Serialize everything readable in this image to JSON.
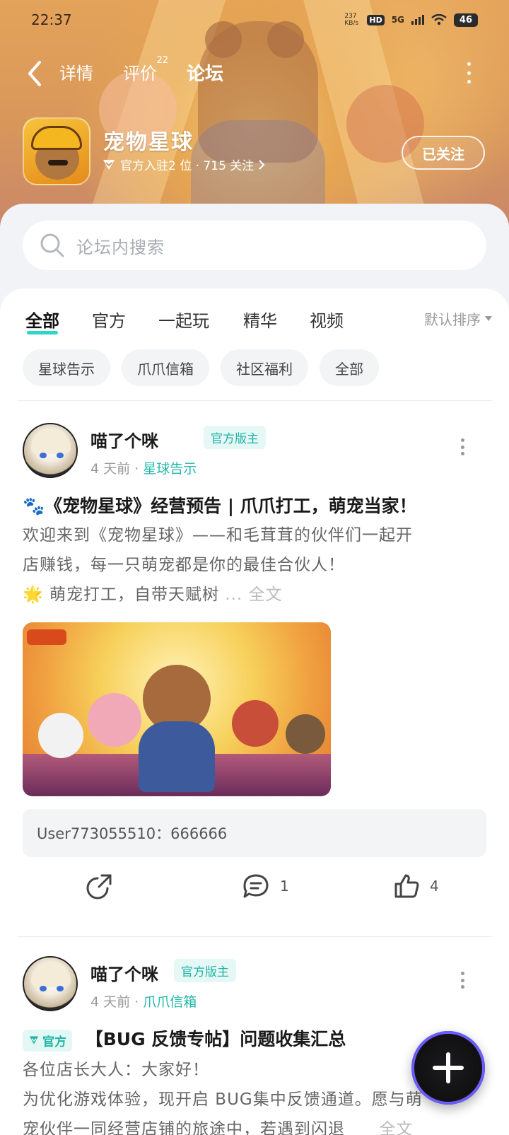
{
  "status_bar": {
    "time": "22:37",
    "net_speed": "237 KB/s",
    "hd": "HD",
    "network": "5G",
    "battery": "46"
  },
  "nav": {
    "tabs": [
      {
        "label": "详情"
      },
      {
        "label": "评价",
        "count": "22"
      },
      {
        "label": "论坛",
        "active": true
      }
    ]
  },
  "game": {
    "title": "宠物星球",
    "meta": "官方入驻2 位 · 715 关注",
    "follow_label": "已关注"
  },
  "search": {
    "placeholder": "论坛内搜索"
  },
  "category_tabs": [
    "全部",
    "官方",
    "一起玩",
    "精华",
    "视频"
  ],
  "sort_label": "默认排序",
  "chips": [
    "星球告示",
    "爪爪信箱",
    "社区福利",
    "全部"
  ],
  "posts": [
    {
      "author": "喵了个咪",
      "badge": "官方版主",
      "time": "4 天前",
      "board": "星球告示",
      "title": "🐾《宠物星球》经营预告 | 爪爪打工，萌宠当家！",
      "body_line1": "欢迎来到《宠物星球》——和毛茸茸的伙伴们一起开",
      "body_line2": "店赚钱，每一只萌宠都是你的最佳合伙人！",
      "body_line3": "🌟 萌宠打工，自带天赋树",
      "more_ellipsis": " ... ",
      "more_label": "全文",
      "reply": "User773055510：666666",
      "comments": "1",
      "likes": "4"
    },
    {
      "author": "喵了个咪",
      "badge": "官方版主",
      "time": "4 天前",
      "board": "爪爪信箱",
      "tag": "官方",
      "title": "【BUG 反馈专帖】问题收集汇总",
      "body_line1": "各位店长大人：大家好！",
      "body_line2": "为优化游戏体验，现开启 BUG集中反馈通道。愿与萌",
      "body_line3": "宠伙伴一同经营店铺的旅途中，若遇到闪退",
      "more_label": "全文"
    }
  ],
  "colors": {
    "accent": "#2ed6c6",
    "board_link": "#22b7a8",
    "header_bg": "#e4a35a"
  }
}
